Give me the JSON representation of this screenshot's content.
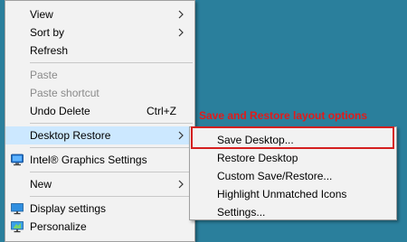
{
  "context_menu": {
    "items": [
      {
        "label": "View"
      },
      {
        "label": "Sort by"
      },
      {
        "label": "Refresh"
      },
      {
        "label": "Paste"
      },
      {
        "label": "Paste shortcut"
      },
      {
        "label": "Undo Delete",
        "shortcut": "Ctrl+Z"
      },
      {
        "label": "Desktop Restore"
      },
      {
        "label": "Intel® Graphics Settings"
      },
      {
        "label": "New"
      },
      {
        "label": "Display settings"
      },
      {
        "label": "Personalize"
      }
    ]
  },
  "submenu": {
    "items": [
      {
        "label": "Save Desktop..."
      },
      {
        "label": "Restore Desktop"
      },
      {
        "label": "Custom Save/Restore..."
      },
      {
        "label": "Highlight Unmatched Icons"
      },
      {
        "label": "Settings..."
      }
    ]
  },
  "annotation": {
    "text": "Save and Restore layout options",
    "color": "#e11b1b"
  },
  "colors": {
    "desktop_background": "#2a7f9c",
    "menu_background": "#f2f2f2",
    "highlight": "#cce8ff"
  },
  "icons": {
    "intel_graphics": "intel-graphics-icon",
    "display_settings": "display-settings-icon",
    "personalize": "personalize-icon"
  }
}
